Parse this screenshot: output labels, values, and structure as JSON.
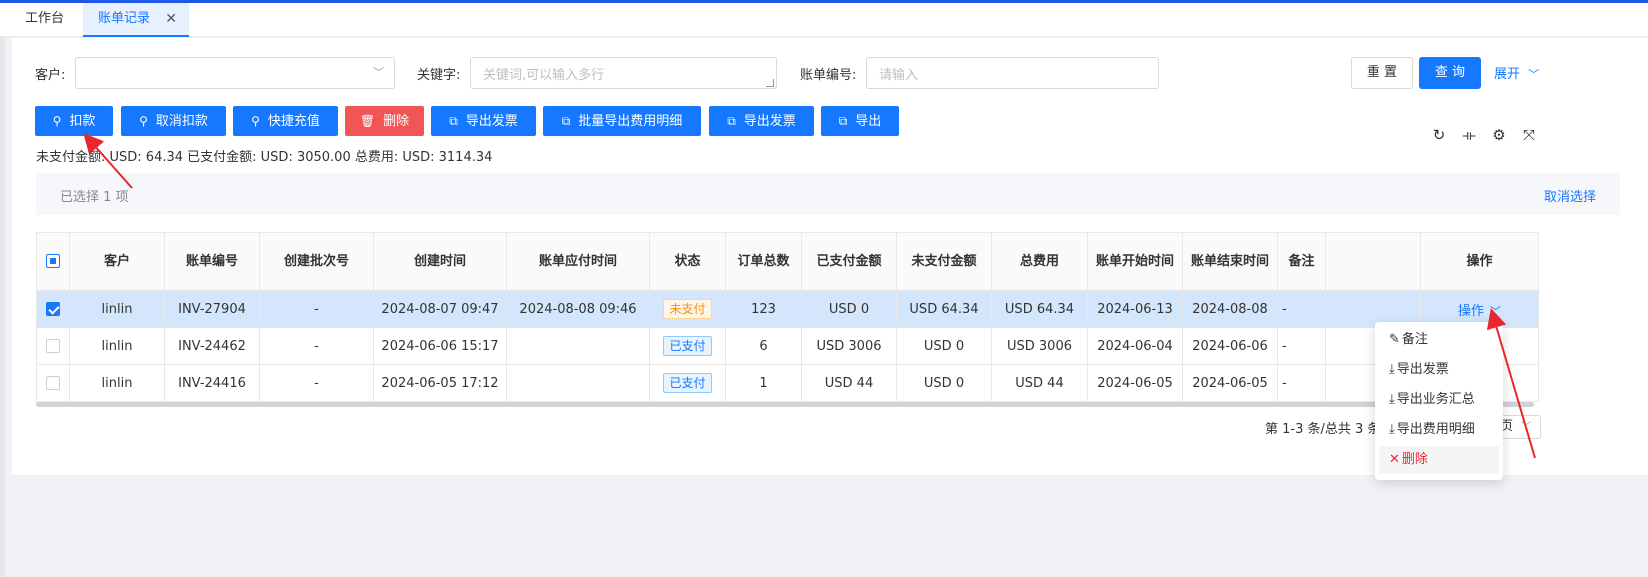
{
  "tabs": [
    {
      "label": "工作台"
    },
    {
      "label": "账单记录",
      "close": "✕"
    }
  ],
  "filters": {
    "customer_label": "客户:",
    "customer_value": "",
    "keyword_label": "关键字:",
    "keyword_placeholder": "关键词,可以输入多行",
    "bill_no_label": "账单编号:",
    "bill_no_placeholder": "请输入",
    "reset": "重 置",
    "query": "查 询",
    "expand": "展开"
  },
  "actions": [
    "扣款",
    "取消扣款",
    "快捷充值",
    "删除",
    "导出发票",
    "批量导出费用明细",
    "导出发票",
    "导出"
  ],
  "summary": "未支付金额: USD: 64.34  已支付金额: USD: 3050.00  总费用: USD: 3114.34",
  "selection": {
    "text": "已选择  1  项",
    "cancel": "取消选择"
  },
  "table": {
    "headers": [
      "客户",
      "账单编号",
      "创建批次号",
      "创建时间",
      "账单应付时间",
      "状态",
      "订单总数",
      "已支付金额",
      "未支付金额",
      "总费用",
      "账单开始时间",
      "账单结束时间",
      "备注",
      "",
      "操作"
    ],
    "rows": [
      {
        "customer": "linlin",
        "bill_no": "INV-27904",
        "batch": "-",
        "created": "2024-08-07 09:47",
        "due": "2024-08-08 09:46",
        "status": "未支付",
        "orders": "123",
        "paid": "USD 0",
        "unpaid": "USD 64.34",
        "total": "USD 64.34",
        "start": "2024-06-13",
        "end": "2024-08-08",
        "note": "-",
        "op": "操作"
      },
      {
        "customer": "linlin",
        "bill_no": "INV-24462",
        "batch": "-",
        "created": "2024-06-06 15:17",
        "due": "",
        "status": "已支付",
        "orders": "6",
        "paid": "USD 3006",
        "unpaid": "USD 0",
        "total": "USD 3006",
        "start": "2024-06-04",
        "end": "2024-06-06",
        "note": "-",
        "op": ""
      },
      {
        "customer": "linlin",
        "bill_no": "INV-24416",
        "batch": "-",
        "created": "2024-06-05 17:12",
        "due": "",
        "status": "已支付",
        "orders": "1",
        "paid": "USD 44",
        "unpaid": "USD 0",
        "total": "USD 44",
        "start": "2024-06-05",
        "end": "2024-06-05",
        "note": "-",
        "op": ""
      }
    ]
  },
  "pager": {
    "info": "第 1-3 条/总共 3 条",
    "size": "页"
  },
  "dropdown": [
    "备注",
    "导出发票",
    "导出业务汇总",
    "导出费用明细",
    "删除"
  ],
  "colors": {
    "primary": "#1677ff",
    "danger": "#f25555",
    "annotation": "#e8262b"
  }
}
